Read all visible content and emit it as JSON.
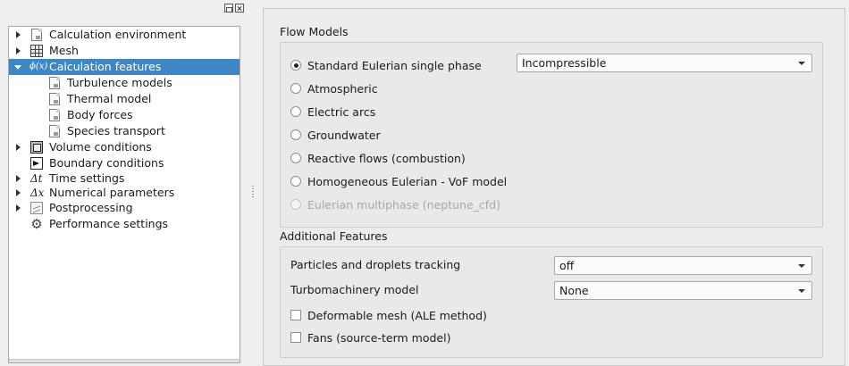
{
  "tree": {
    "items": [
      {
        "label": "Calculation environment",
        "icon": "document-icon"
      },
      {
        "label": "Mesh",
        "icon": "mesh-icon"
      },
      {
        "label": "Calculation features",
        "icon": "phi-formula-icon",
        "glyph": "ϕ(x)"
      },
      {
        "label": "Turbulence models",
        "icon": "document-icon"
      },
      {
        "label": "Thermal model",
        "icon": "document-icon"
      },
      {
        "label": "Body forces",
        "icon": "document-icon"
      },
      {
        "label": "Species transport",
        "icon": "document-icon"
      },
      {
        "label": "Volume conditions",
        "icon": "volume-cube-icon"
      },
      {
        "label": "Boundary conditions",
        "icon": "boundary-arrow-icon"
      },
      {
        "label": "Time settings",
        "icon": "delta-t-icon",
        "glyph": "Δt"
      },
      {
        "label": "Numerical parameters",
        "icon": "delta-x-icon",
        "glyph": "Δx"
      },
      {
        "label": "Postprocessing",
        "icon": "chart-icon"
      },
      {
        "label": "Performance settings",
        "icon": "gear-icon",
        "glyph": "⚙"
      }
    ]
  },
  "flow_models": {
    "title": "Flow Models",
    "options": [
      "Standard Eulerian single phase",
      "Atmospheric",
      "Electric arcs",
      "Groundwater",
      "Reactive flows (combustion)",
      "Homogeneous Eulerian - VoF model",
      "Eulerian multiphase (neptune_cfd)"
    ],
    "selected_index": 0,
    "disabled_index": 6,
    "compressibility_value": "Incompressible"
  },
  "additional_features": {
    "title": "Additional Features",
    "particles_label": "Particles and droplets tracking",
    "particles_value": "off",
    "turbomachinery_label": "Turbomachinery model",
    "turbomachinery_value": "None",
    "deformable_mesh_label": "Deformable mesh (ALE method)",
    "fans_label": "Fans (source-term model)"
  },
  "colors": {
    "selection": "#3c87c6",
    "background": "#efefef"
  }
}
